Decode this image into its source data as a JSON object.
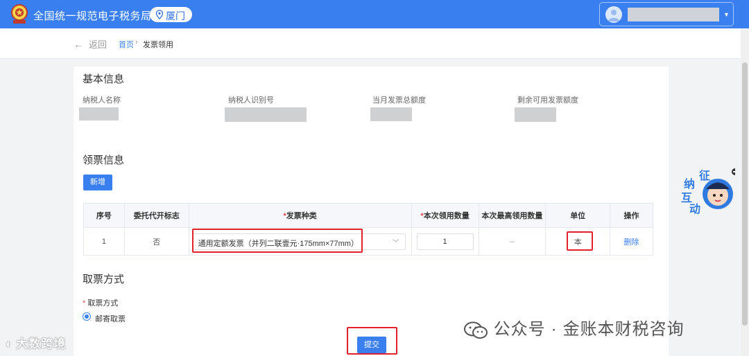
{
  "header": {
    "site_title": "全国统一规范电子税务局",
    "city": "厦门"
  },
  "breadcrumb": {
    "back_label": "返回",
    "home": "首页",
    "separator": "›",
    "current": "发票领用"
  },
  "basic_info": {
    "title": "基本信息",
    "fields": [
      {
        "label": "纳税人名称"
      },
      {
        "label": "纳税人识别号"
      },
      {
        "label": "当月发票总额度"
      },
      {
        "label": "剩余可用发票额度"
      }
    ]
  },
  "ticket_info": {
    "title": "领票信息",
    "add_button": "新增",
    "columns": [
      "序号",
      "委托代开标志",
      "发票种类",
      "本次领用数量",
      "本次最高领用数量",
      "单位",
      "操作"
    ],
    "required_mark": "*",
    "rows": [
      {
        "index": "1",
        "agent_flag": "否",
        "invoice_type": "通用定额发票（并列二联壹元·175mm×77mm）",
        "quantity": "1",
        "max_quantity": "--",
        "unit": "本",
        "action": "删除"
      }
    ]
  },
  "pickup": {
    "title": "取票方式",
    "field_label": "取票方式",
    "required_mark": "*",
    "option": "邮寄取票",
    "submit": "提交"
  },
  "watermarks": {
    "left": "大数跨境",
    "right_prefix": "公众号",
    "right_dot": "·",
    "right_name": "金账本财税咨询"
  },
  "mascot": {
    "chars": [
      "征",
      "纳",
      "互",
      "动"
    ]
  },
  "colors": {
    "brand_blue": "#3a7ff0",
    "highlight_red": "#e0202a"
  }
}
